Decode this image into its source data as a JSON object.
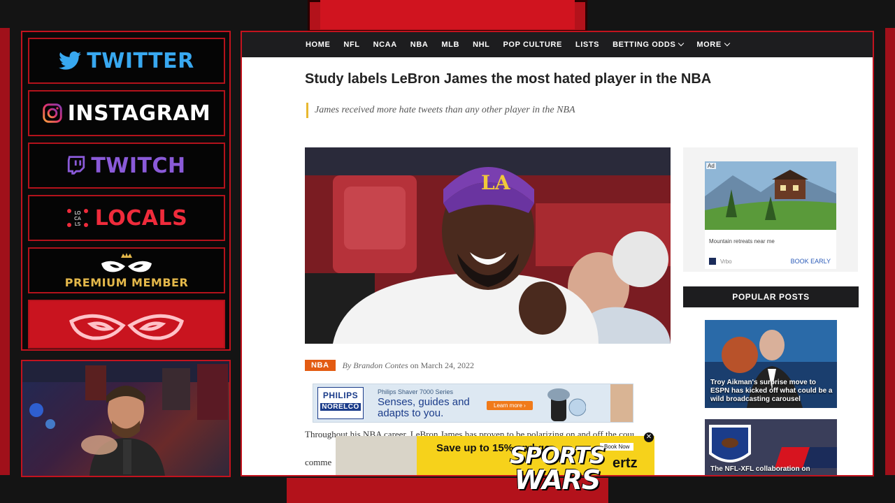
{
  "social": {
    "twitter": "TWITTER",
    "instagram": "INSTAGRAM",
    "twitch": "TWITCH",
    "locals": "LOCALS",
    "locals_icon_text": "LOCALS",
    "premium": "PREMIUM MEMBER"
  },
  "nav": {
    "items": [
      "HOME",
      "NFL",
      "NCAA",
      "NBA",
      "MLB",
      "NHL",
      "POP CULTURE",
      "LISTS",
      "BETTING ODDS",
      "MORE"
    ]
  },
  "article": {
    "headline": "Study labels LeBron James the most hated player in the NBA",
    "subhead": "James received more hate tweets than any other player in the NBA",
    "tag": "NBA",
    "by_prefix": "By",
    "author": "Brandon Contes",
    "date_prefix": "on",
    "date": "March 24, 2022",
    "body": "Throughout his NBA career, LeBron James has proven to be polarizing on and off the court. L",
    "body_line3": "comme"
  },
  "ads": {
    "philips_brand_1": "PHILIPS",
    "philips_brand_2": "NORELCO",
    "philips_small": "Philips Shaver 7000 Series",
    "philips_tagline": "Senses, guides and adapts to you.",
    "philips_cta": "Learn more ›",
    "hertz_text": "Save up to 15% and go.",
    "hertz_cta": "Book Now",
    "hertz_brand": "ertz",
    "side_ad_label": "Ad",
    "side_ad_caption": "Mountain retreats near me",
    "side_ad_source": "Vrbo",
    "side_ad_cta": "BOOK EARLY"
  },
  "sidebar": {
    "popular_header": "POPULAR POSTS",
    "post1_title": "Troy Aikman's surprise move to ESPN has kicked off what could be a wild broadcasting carousel",
    "post2_title": "The NFL-XFL collaboration on"
  },
  "stream": {
    "logo_line1": "SPORTS",
    "logo_line2": "WARS"
  },
  "colors": {
    "accent_red": "#c3131e",
    "nav_bg": "#1d1d1f",
    "tag_orange": "#e35b12",
    "twitter_blue": "#38a8f0",
    "twitch_purple": "#8a5ad8",
    "premium_gold": "#e4b84a"
  }
}
